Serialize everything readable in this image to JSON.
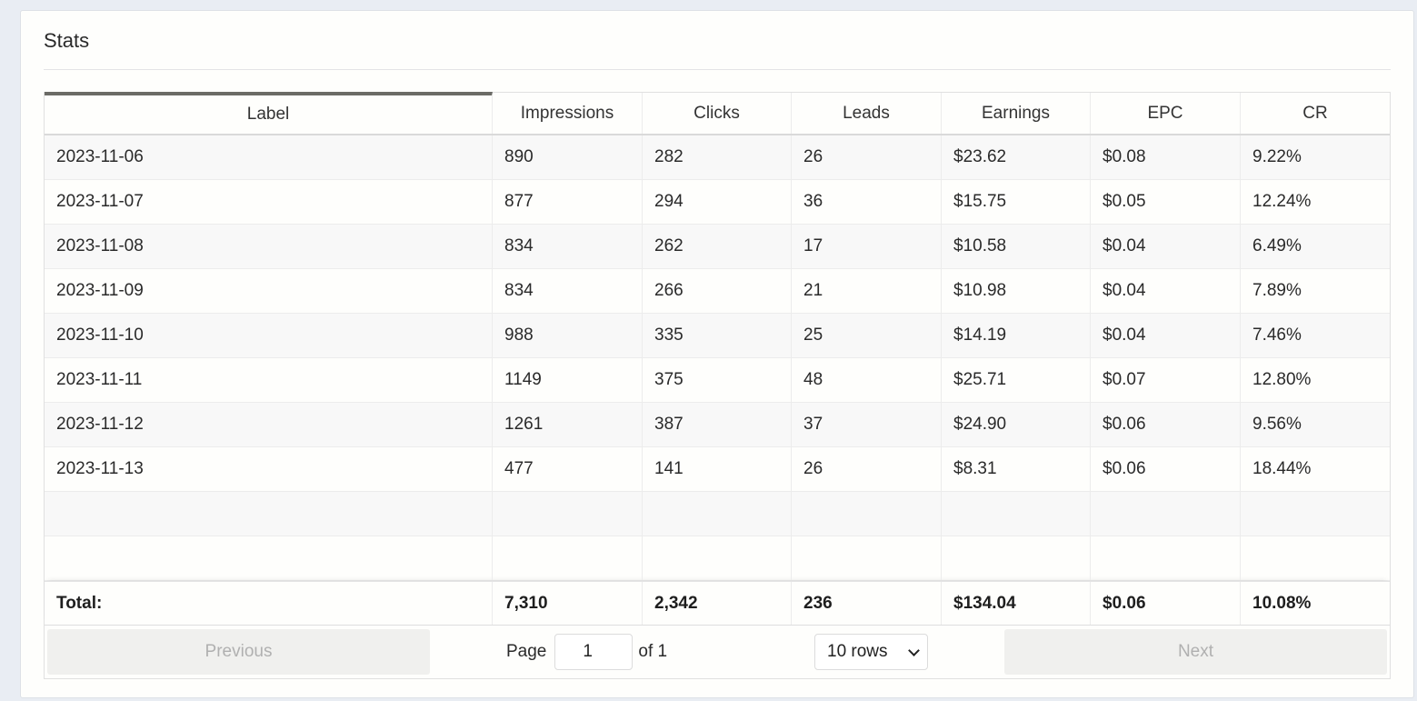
{
  "card": {
    "title": "Stats"
  },
  "table": {
    "columns": [
      "Label",
      "Impressions",
      "Clicks",
      "Leads",
      "Earnings",
      "EPC",
      "CR"
    ],
    "rows": [
      [
        "2023-11-06",
        "890",
        "282",
        "26",
        "$23.62",
        "$0.08",
        "9.22%"
      ],
      [
        "2023-11-07",
        "877",
        "294",
        "36",
        "$15.75",
        "$0.05",
        "12.24%"
      ],
      [
        "2023-11-08",
        "834",
        "262",
        "17",
        "$10.58",
        "$0.04",
        "6.49%"
      ],
      [
        "2023-11-09",
        "834",
        "266",
        "21",
        "$10.98",
        "$0.04",
        "7.89%"
      ],
      [
        "2023-11-10",
        "988",
        "335",
        "25",
        "$14.19",
        "$0.04",
        "7.46%"
      ],
      [
        "2023-11-11",
        "1149",
        "375",
        "48",
        "$25.71",
        "$0.07",
        "12.80%"
      ],
      [
        "2023-11-12",
        "1261",
        "387",
        "37",
        "$24.90",
        "$0.06",
        "9.56%"
      ],
      [
        "2023-11-13",
        "477",
        "141",
        "26",
        "$8.31",
        "$0.06",
        "18.44%"
      ],
      [
        "",
        "",
        "",
        "",
        "",
        "",
        ""
      ],
      [
        "",
        "",
        "",
        "",
        "",
        "",
        ""
      ]
    ],
    "totals": [
      "Total:",
      "7,310",
      "2,342",
      "236",
      "$134.04",
      "$0.06",
      "10.08%"
    ]
  },
  "pagination": {
    "previous_label": "Previous",
    "next_label": "Next",
    "page_label": "Page",
    "page_value": "1",
    "of_label": "of 1",
    "rows_selected": "10 rows"
  }
}
